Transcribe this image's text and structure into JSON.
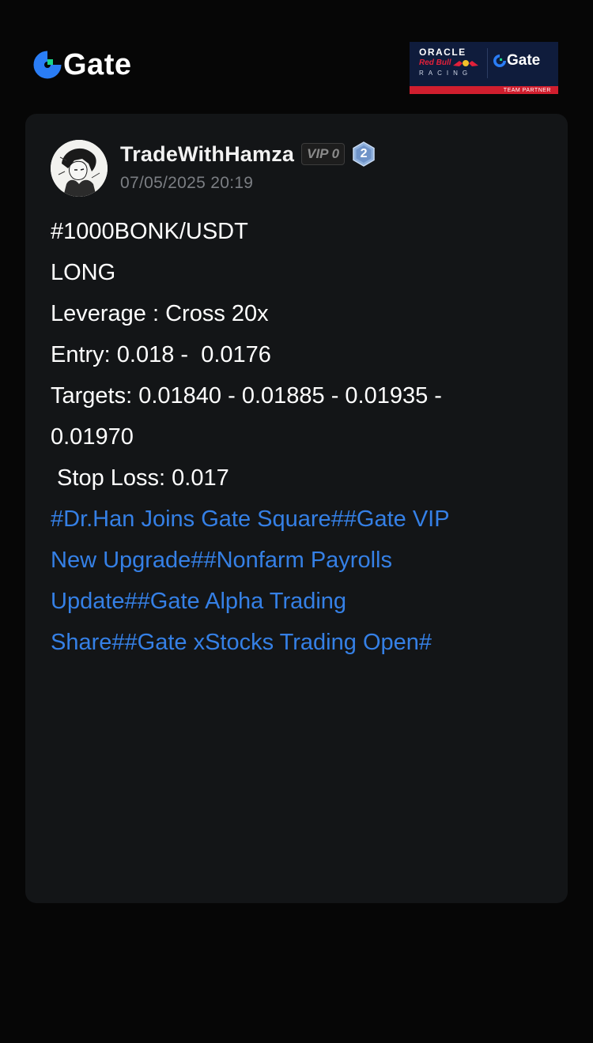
{
  "header": {
    "brand_name": "Gate",
    "partner": {
      "oracle": "ORACLE",
      "redbull": "Red Bull",
      "racing": "RACING",
      "gate": "Gate",
      "band_text": "TEAM PARTNER"
    }
  },
  "post": {
    "author": "TradeWithHamza",
    "vip_label": "VIP 0",
    "level": "2",
    "timestamp": "07/05/2025 20:19",
    "lines": [
      "#1000BONK/USDT",
      "LONG",
      "Leverage : Cross 20x",
      "Entry: 0.018 -  0.0176",
      "Targets: 0.01840 - 0.01885 - 0.01935 -",
      "0.01970",
      " Stop Loss: 0.017"
    ],
    "hashtag_lines": [
      "#Dr.Han Joins Gate Square##Gate VIP",
      "New Upgrade##Nonfarm Payrolls",
      "Update##Gate Alpha Trading",
      "Share##Gate xStocks Trading Open#"
    ]
  },
  "colors": {
    "background": "#060606",
    "card": "#131517",
    "accent": "#3580e6",
    "brand_blue": "#2a7df5",
    "brand_green": "#18d68a",
    "partner_navy": "#0f1c3c",
    "partner_red": "#d01e2e",
    "muted_text": "#7b7e83"
  },
  "icons": {
    "brand": "gate-logo-icon",
    "level": "level-hexagon-icon",
    "avatar": "user-avatar"
  }
}
